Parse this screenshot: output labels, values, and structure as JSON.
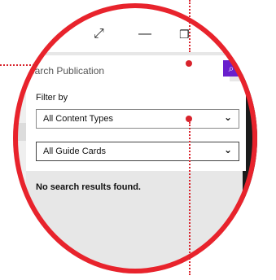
{
  "window": {
    "expand_icon": "expand-arrows-icon",
    "minimize_icon": "minimize-icon",
    "restore_icon": "restore-icon"
  },
  "search": {
    "placeholder": "Search Publication",
    "button_icon": "search-icon"
  },
  "filter": {
    "label": "Filter by",
    "content_type": "All Content Types",
    "guide_cards": "All Guide Cards",
    "dropdown_icon": "chevron-down-icon"
  },
  "results": {
    "message": "No search results found."
  },
  "callout": {
    "ring_color": "#e8232c",
    "accent_color": "#6a1fcd"
  }
}
